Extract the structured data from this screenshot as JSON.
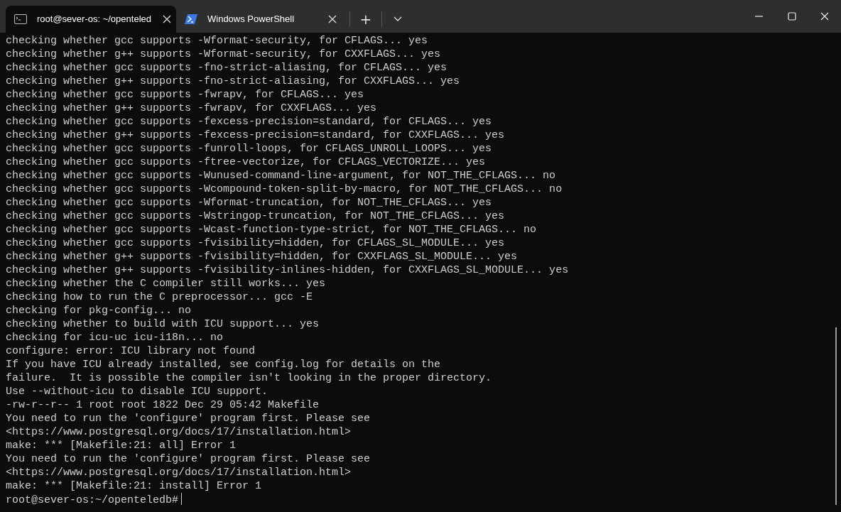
{
  "tabs": [
    {
      "kind": "terminal",
      "label": "root@sever-os: ~/openteled",
      "selected": true
    },
    {
      "kind": "powershell",
      "label": "Windows PowerShell",
      "selected": false
    }
  ],
  "window_controls": {
    "new_tab": "+"
  },
  "terminal": {
    "lines": [
      "checking whether gcc supports -Wformat-security, for CFLAGS... yes",
      "checking whether g++ supports -Wformat-security, for CXXFLAGS... yes",
      "checking whether gcc supports -fno-strict-aliasing, for CFLAGS... yes",
      "checking whether g++ supports -fno-strict-aliasing, for CXXFLAGS... yes",
      "checking whether gcc supports -fwrapv, for CFLAGS... yes",
      "checking whether g++ supports -fwrapv, for CXXFLAGS... yes",
      "checking whether gcc supports -fexcess-precision=standard, for CFLAGS... yes",
      "checking whether g++ supports -fexcess-precision=standard, for CXXFLAGS... yes",
      "checking whether gcc supports -funroll-loops, for CFLAGS_UNROLL_LOOPS... yes",
      "checking whether gcc supports -ftree-vectorize, for CFLAGS_VECTORIZE... yes",
      "checking whether gcc supports -Wunused-command-line-argument, for NOT_THE_CFLAGS... no",
      "checking whether gcc supports -Wcompound-token-split-by-macro, for NOT_THE_CFLAGS... no",
      "checking whether gcc supports -Wformat-truncation, for NOT_THE_CFLAGS... yes",
      "checking whether gcc supports -Wstringop-truncation, for NOT_THE_CFLAGS... yes",
      "checking whether gcc supports -Wcast-function-type-strict, for NOT_THE_CFLAGS... no",
      "checking whether gcc supports -fvisibility=hidden, for CFLAGS_SL_MODULE... yes",
      "checking whether g++ supports -fvisibility=hidden, for CXXFLAGS_SL_MODULE... yes",
      "checking whether g++ supports -fvisibility-inlines-hidden, for CXXFLAGS_SL_MODULE... yes",
      "checking whether the C compiler still works... yes",
      "checking how to run the C preprocessor... gcc -E",
      "checking for pkg-config... no",
      "checking whether to build with ICU support... yes",
      "checking for icu-uc icu-i18n... no",
      "configure: error: ICU library not found",
      "If you have ICU already installed, see config.log for details on the",
      "failure.  It is possible the compiler isn't looking in the proper directory.",
      "Use --without-icu to disable ICU support.",
      "-rw-r--r-- 1 root root 1822 Dec 29 05:42 Makefile",
      "You need to run the 'configure' program first. Please see",
      "<https://www.postgresql.org/docs/17/installation.html>",
      "make: *** [Makefile:21: all] Error 1",
      "You need to run the 'configure' program first. Please see",
      "<https://www.postgresql.org/docs/17/installation.html>",
      "make: *** [Makefile:21: install] Error 1"
    ],
    "prompt": "root@sever-os:~/openteledb#"
  }
}
